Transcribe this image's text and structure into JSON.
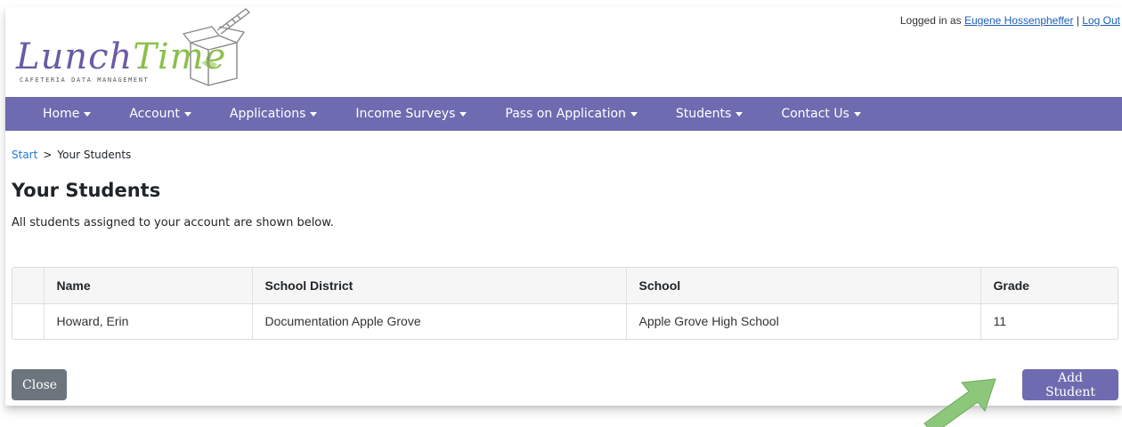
{
  "header": {
    "logo": {
      "word_lunch": "Lunch",
      "word_time": "Time",
      "tagline": "Cafeteria Data Management"
    },
    "login": {
      "prefix": "Logged in as",
      "user": "Eugene Hossenpheffer",
      "separator": "|",
      "logout": "Log Out"
    }
  },
  "nav": {
    "items": [
      {
        "label": "Home"
      },
      {
        "label": "Account"
      },
      {
        "label": "Applications"
      },
      {
        "label": "Income Surveys"
      },
      {
        "label": "Pass on Application"
      },
      {
        "label": "Students"
      },
      {
        "label": "Contact Us"
      }
    ]
  },
  "breadcrumb": {
    "start": "Start",
    "separator": ">",
    "current": "Your Students"
  },
  "page": {
    "title": "Your Students",
    "description": "All students assigned to your account are shown below."
  },
  "table": {
    "headers": [
      "",
      "Name",
      "School District",
      "School",
      "Grade"
    ],
    "rows": [
      [
        "",
        "Howard, Erin",
        "Documentation Apple Grove",
        "Apple Grove High School",
        "11"
      ]
    ]
  },
  "buttons": {
    "close": "Close",
    "add": "Add Student"
  },
  "colors": {
    "nav": "#6f6bb0",
    "close_button": "#6c757d",
    "add_button": "#6f6bb0",
    "arrow": "#8cc77a"
  },
  "icons": {
    "callout": "arrow-up-right-icon",
    "nav_dropdown": "caret-down-icon"
  }
}
